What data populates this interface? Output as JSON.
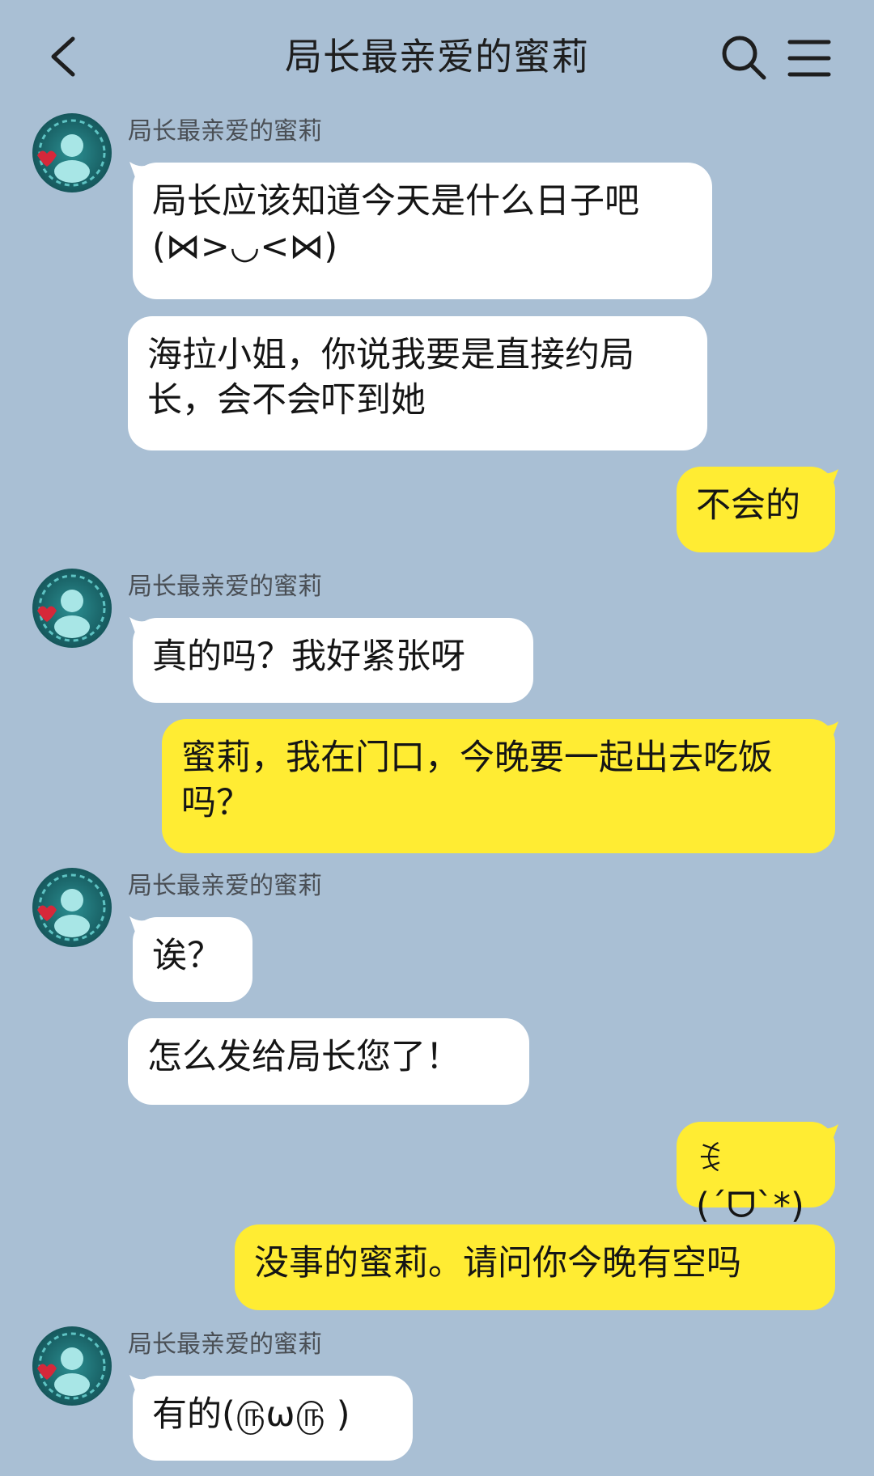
{
  "header": {
    "title": "局长最亲爱的蜜莉"
  },
  "contact": {
    "name": "局长最亲爱的蜜莉"
  },
  "messages": [
    {
      "side": "in",
      "text": "局长应该知道今天是什么日子吧(⋈>◡<⋈)"
    },
    {
      "side": "in",
      "text": "海拉小姐，你说我要是直接约局长，会不会吓到她"
    },
    {
      "side": "out",
      "text": "不会的"
    },
    {
      "side": "in",
      "text": "真的吗？我好紧张呀"
    },
    {
      "side": "out",
      "text": "蜜莉，我在门口，今晚要一起出去吃饭吗？"
    },
    {
      "side": "in",
      "text": "诶？"
    },
    {
      "side": "in",
      "text": "怎么发给局长您了！"
    },
    {
      "side": "out",
      "text": "ꉂ(ˊᗜˋ*)"
    },
    {
      "side": "out",
      "text": "没事的蜜莉。请问你今晚有空吗"
    },
    {
      "side": "in",
      "text": "有的(௫ω௫ )"
    }
  ],
  "colors": {
    "background": "#a9bfd4",
    "incoming_bubble": "#ffffff",
    "outgoing_bubble": "#ffec33"
  },
  "icons": {
    "back": "chevron-left-icon",
    "search": "search-icon",
    "menu": "menu-icon",
    "avatar": "avatar-image"
  }
}
